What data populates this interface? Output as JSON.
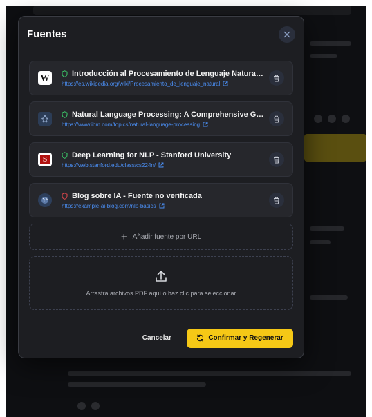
{
  "modal": {
    "title": "Fuentes",
    "close_icon": "close-icon"
  },
  "sources": [
    {
      "favicon": "wikipedia-logo",
      "verified": true,
      "title": "Introducción al Procesamiento de Lenguaje Natural - Wikipe...",
      "url": "https://es.wikipedia.org/wiki/Procesamiento_de_lenguaje_natural"
    },
    {
      "favicon": "ibm-logo",
      "verified": true,
      "title": "Natural Language Processing: A Comprehensive Guide",
      "url": "https://www.ibm.com/topics/natural-language-processing"
    },
    {
      "favicon": "stanford-logo",
      "verified": true,
      "title": "Deep Learning for NLP - Stanford University",
      "url": "https://web.stanford.edu/class/cs224n/"
    },
    {
      "favicon": "globe-icon",
      "verified": false,
      "title": "Blog sobre IA - Fuente no verificada",
      "url": "https://example-ai-blog.com/nlp-basics"
    }
  ],
  "add_url": {
    "label": "Añadir fuente por URL"
  },
  "dropzone": {
    "label": "Arrastra archivos PDF aquí o haz clic para seleccionar"
  },
  "footer": {
    "cancel_label": "Cancelar",
    "confirm_label": "Confirmar y Regenerar"
  },
  "colors": {
    "accent": "#f5c816",
    "link": "#4b8ff5",
    "verified": "#3ccf6b",
    "unverified": "#e5484d"
  }
}
